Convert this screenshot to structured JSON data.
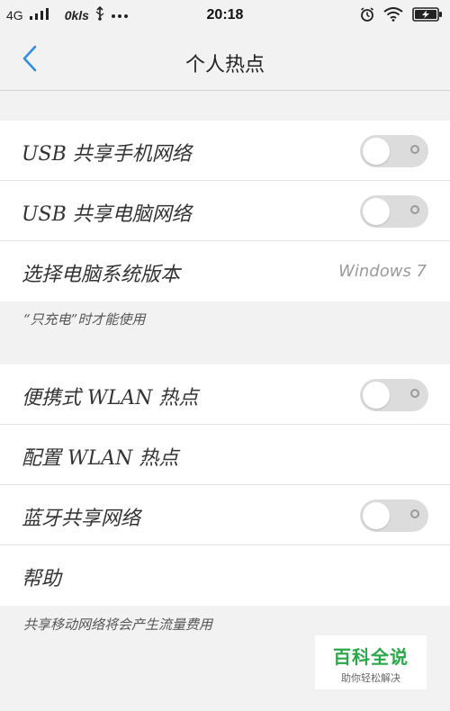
{
  "status_bar": {
    "network": "4G",
    "speed": "0kls",
    "time": "20:18",
    "icons": [
      "signal-icon",
      "usb-icon",
      "more-icon",
      "alarm-icon",
      "wifi-icon",
      "battery-charging-icon"
    ]
  },
  "nav": {
    "title": "个人热点",
    "back_icon": "chevron-left-icon"
  },
  "group1": {
    "rows": [
      {
        "label": "USB 共享手机网络",
        "toggle": false
      },
      {
        "label": "USB 共享电脑网络",
        "toggle": false
      },
      {
        "label": "选择电脑系统版本",
        "value": "Windows 7"
      }
    ],
    "footnote": "“只充电”时才能使用"
  },
  "group2": {
    "rows": [
      {
        "label": "便携式 WLAN 热点",
        "toggle": false
      },
      {
        "label": "配置 WLAN 热点"
      },
      {
        "label": "蓝牙共享网络",
        "toggle": false
      },
      {
        "label": "帮助"
      }
    ],
    "footnote": "共享移动网络将会产生流量费用"
  },
  "watermark": {
    "title": "百科全说",
    "subtitle": "助你轻松解决"
  },
  "colors": {
    "accent": "#2f8fe0",
    "background": "#f2f2f2",
    "toggle_off": "#dcdcdc",
    "watermark_green": "#2aa748"
  }
}
